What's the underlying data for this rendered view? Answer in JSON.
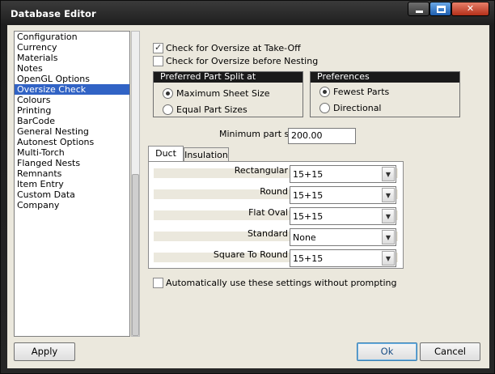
{
  "window": {
    "title": "Database Editor"
  },
  "nav": {
    "items": [
      "Configuration",
      "Currency",
      "Materials",
      "Notes",
      "OpenGL Options",
      "Oversize Check",
      "Colours",
      "Printing",
      "BarCode",
      "General Nesting",
      "Autonest Options",
      "Multi-Torch",
      "Flanged Nests",
      "Remnants",
      "Item Entry",
      "Custom Data",
      "Company"
    ],
    "selected": "Oversize Check"
  },
  "options": {
    "check_takeoff": {
      "label": "Check for Oversize at Take-Off",
      "checked": true
    },
    "check_nesting": {
      "label": "Check for Oversize before Nesting",
      "checked": false
    }
  },
  "preferred_split": {
    "title": "Preferred Part Split at",
    "options": [
      {
        "label": "Maximum Sheet Size",
        "selected": true
      },
      {
        "label": "Equal Part Sizes",
        "selected": false
      }
    ]
  },
  "preferences": {
    "title": "Preferences",
    "options": [
      {
        "label": "Fewest Parts",
        "selected": true
      },
      {
        "label": "Directional",
        "selected": false
      }
    ]
  },
  "min_part": {
    "label": "Minimum part size",
    "value": "200.00"
  },
  "tabs": [
    {
      "label": "Duct",
      "active": true
    },
    {
      "label": "Insulation",
      "active": false
    }
  ],
  "shapes": [
    {
      "label": "Rectangular",
      "value": "15+15"
    },
    {
      "label": "Round",
      "value": "15+15"
    },
    {
      "label": "Flat Oval",
      "value": "15+15"
    },
    {
      "label": "Standard",
      "value": "None"
    },
    {
      "label": "Square To Round",
      "value": "15+15"
    }
  ],
  "auto": {
    "label": "Automatically use these settings without prompting",
    "checked": false
  },
  "buttons": {
    "apply": "Apply",
    "ok": "Ok",
    "cancel": "Cancel"
  },
  "colors": {
    "selection": "#3163c5",
    "group_header": "#1a1a1a"
  },
  "icons": {
    "minimize": "minimize-icon",
    "maximize": "maximize-icon",
    "close": "close-icon",
    "dropdown": "chevron-down-icon",
    "check": "checkmark-icon"
  }
}
